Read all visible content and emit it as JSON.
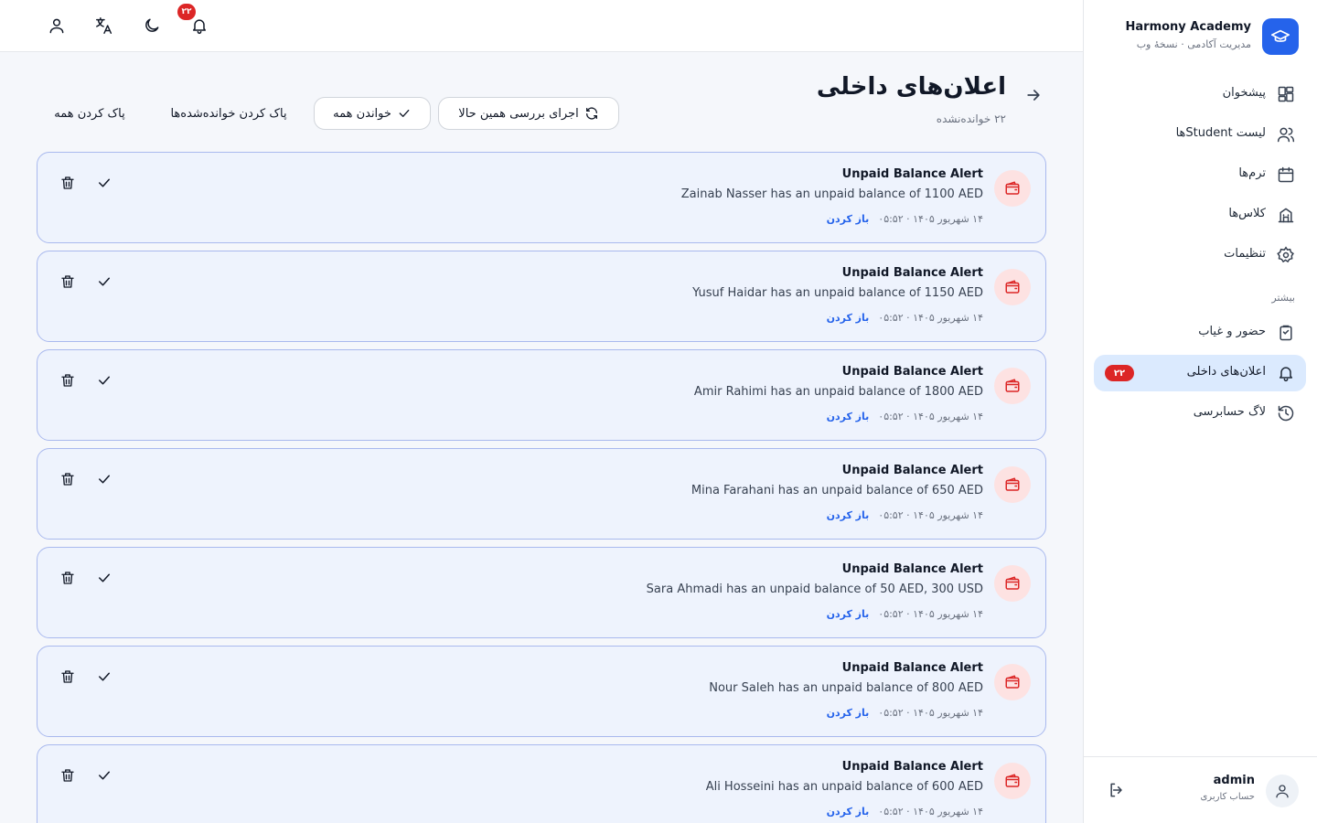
{
  "brand": {
    "title": "Harmony Academy",
    "subtitle": "مدیریت آکادمی · نسخهٔ وب"
  },
  "nav": {
    "items": [
      {
        "label": "پیشخوان",
        "icon": "dashboard-icon"
      },
      {
        "label": "لیست Studentها",
        "icon": "users-icon"
      },
      {
        "label": "ترم‌ها",
        "icon": "calendar-icon"
      },
      {
        "label": "کلاس‌ها",
        "icon": "building-icon"
      },
      {
        "label": "تنظیمات",
        "icon": "gear-icon"
      }
    ],
    "section_title": "بیشتر",
    "more_items": [
      {
        "label": "حضور و غیاب",
        "icon": "clipboard-icon"
      },
      {
        "label": "اعلان‌های داخلی",
        "icon": "bell-icon",
        "badge": "۲۲",
        "active": true
      },
      {
        "label": "لاگ حسابرسی",
        "icon": "history-icon"
      }
    ]
  },
  "user": {
    "name": "admin",
    "role": "حساب کاربری"
  },
  "topbar": {
    "notification_count": "۲۲"
  },
  "header": {
    "title": "اعلان‌های داخلی",
    "subtitle": "۲۲ خوانده‌نشده",
    "run_check_label": "اجرای بررسی همین حالا",
    "mark_all_read_label": "خواندن همه",
    "clear_read_label": "پاک کردن خوانده‌شده‌ها",
    "clear_all_label": "پاک کردن همه"
  },
  "notifications": [
    {
      "title": "Unpaid Balance Alert",
      "message": "Zainab Nasser has an unpaid balance of 1100 AED",
      "time": "۱۴ شهریور ۱۴۰۵ · ۰۵:۵۲",
      "open_label": "باز کردن"
    },
    {
      "title": "Unpaid Balance Alert",
      "message": "Yusuf Haidar has an unpaid balance of 1150 AED",
      "time": "۱۴ شهریور ۱۴۰۵ · ۰۵:۵۲",
      "open_label": "باز کردن"
    },
    {
      "title": "Unpaid Balance Alert",
      "message": "Amir Rahimi has an unpaid balance of 1800 AED",
      "time": "۱۴ شهریور ۱۴۰۵ · ۰۵:۵۲",
      "open_label": "باز کردن"
    },
    {
      "title": "Unpaid Balance Alert",
      "message": "Mina Farahani has an unpaid balance of 650 AED",
      "time": "۱۴ شهریور ۱۴۰۵ · ۰۵:۵۲",
      "open_label": "باز کردن"
    },
    {
      "title": "Unpaid Balance Alert",
      "message": "Sara Ahmadi has an unpaid balance of 50 AED, 300 USD",
      "time": "۱۴ شهریور ۱۴۰۵ · ۰۵:۵۲",
      "open_label": "باز کردن"
    },
    {
      "title": "Unpaid Balance Alert",
      "message": "Nour Saleh has an unpaid balance of 800 AED",
      "time": "۱۴ شهریور ۱۴۰۵ · ۰۵:۵۲",
      "open_label": "باز کردن"
    },
    {
      "title": "Unpaid Balance Alert",
      "message": "Ali Hosseini has an unpaid balance of 600 AED",
      "time": "۱۴ شهریور ۱۴۰۵ · ۰۵:۵۲",
      "open_label": "باز کردن"
    }
  ],
  "colors": {
    "accent": "#2563eb",
    "badge": "#dc2626",
    "card_bg": "#eef3fd",
    "card_border": "#a9b9ee",
    "alert_icon_bg": "#fde2e2",
    "alert_icon": "#dc2626"
  }
}
